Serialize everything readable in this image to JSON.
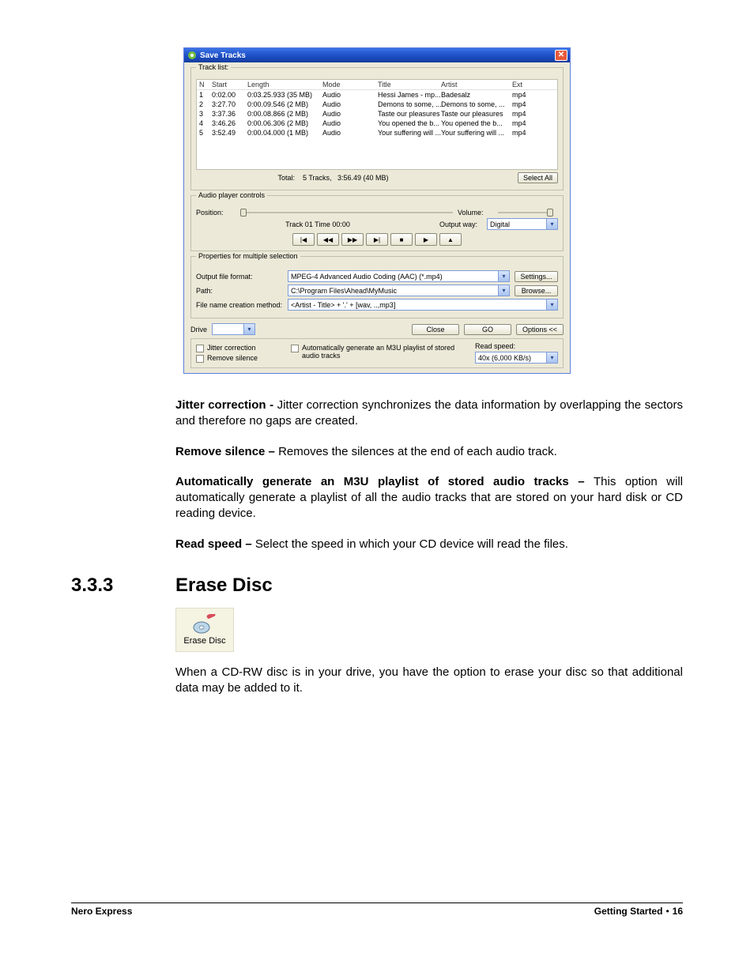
{
  "dialog": {
    "title": "Save Tracks",
    "tracklist_label": "Track list:",
    "columns": {
      "n": "N",
      "start": "Start",
      "length": "Length",
      "mode": "Mode",
      "title": "Title",
      "artist": "Artist",
      "ext": "Ext"
    },
    "rows": [
      {
        "n": "1",
        "start": "0:02.00",
        "length": "0:03.25.933 (35 MB)",
        "mode": "Audio",
        "title": "Hessi James - mp...",
        "artist": "Badesalz",
        "ext": "mp4"
      },
      {
        "n": "2",
        "start": "3:27.70",
        "length": "0:00.09.546 (2 MB)",
        "mode": "Audio",
        "title": "Demons to some, ...",
        "artist": "Demons to some, ...",
        "ext": "mp4"
      },
      {
        "n": "3",
        "start": "3:37.36",
        "length": "0:00.08.866 (2 MB)",
        "mode": "Audio",
        "title": "Taste our pleasures",
        "artist": "Taste our pleasures",
        "ext": "mp4"
      },
      {
        "n": "4",
        "start": "3:46.26",
        "length": "0:00.06.306 (2 MB)",
        "mode": "Audio",
        "title": "You opened the b...",
        "artist": "You opened the b...",
        "ext": "mp4"
      },
      {
        "n": "5",
        "start": "3:52.49",
        "length": "0:00.04.000 (1 MB)",
        "mode": "Audio",
        "title": "Your suffering will ...",
        "artist": "Your suffering will ...",
        "ext": "mp4"
      }
    ],
    "total_label": "Total:",
    "total_value": "5 Tracks,   3:56.49 (40 MB)",
    "select_all": "Select All",
    "audio_controls_legend": "Audio player controls",
    "position_label": "Position:",
    "volume_label": "Volume:",
    "track_time": "Track 01 Time 00:00",
    "output_way_label": "Output way:",
    "output_way_value": "Digital",
    "props_legend": "Properties for multiple selection",
    "output_format_label": "Output file format:",
    "output_format_value": "MPEG-4 Advanced Audio Coding (AAC) (*.mp4)",
    "settings_btn": "Settings...",
    "path_label": "Path:",
    "path_value": "C:\\Program Files\\Ahead\\MyMusic",
    "browse_btn": "Browse...",
    "filename_method_label": "File name creation method:",
    "filename_method_value": "<Artist - Title> + '.' + [wav, ..,mp3]",
    "drive_label": "Drive",
    "close_btn": "Close",
    "go_btn": "GO",
    "options_btn": "Options <<",
    "jitter_check": "Jitter correction",
    "remove_silence_check": "Remove silence",
    "auto_m3u_check": "Automatically generate an M3U playlist of stored audio tracks",
    "read_speed_label": "Read speed:",
    "read_speed_value": "40x (6,000 KB/s)"
  },
  "doc": {
    "p1_bold": "Jitter correction - ",
    "p1_rest": "Jitter correction synchronizes the data information by overlapping the sectors and therefore no gaps are created.",
    "p2_bold": "Remove silence – ",
    "p2_rest": "Removes the silences at the end of each audio track.",
    "p3_bold": "Automatically generate an M3U playlist of stored audio tracks – ",
    "p3_rest": "This option will automatically generate a playlist of all the audio tracks that are stored on your hard disk or CD reading device.",
    "p4_bold": "Read speed – ",
    "p4_rest": "Select the speed in which your CD device will read the files.",
    "section_num": "3.3.3",
    "section_title": "Erase Disc",
    "erase_icon_label": "Erase Disc",
    "p5": "When a CD-RW disc is in your drive, you have the option to erase your disc so that additional data may be added to it."
  },
  "footer": {
    "left": "Nero Express",
    "right_label": "Getting Started",
    "page": "16"
  }
}
